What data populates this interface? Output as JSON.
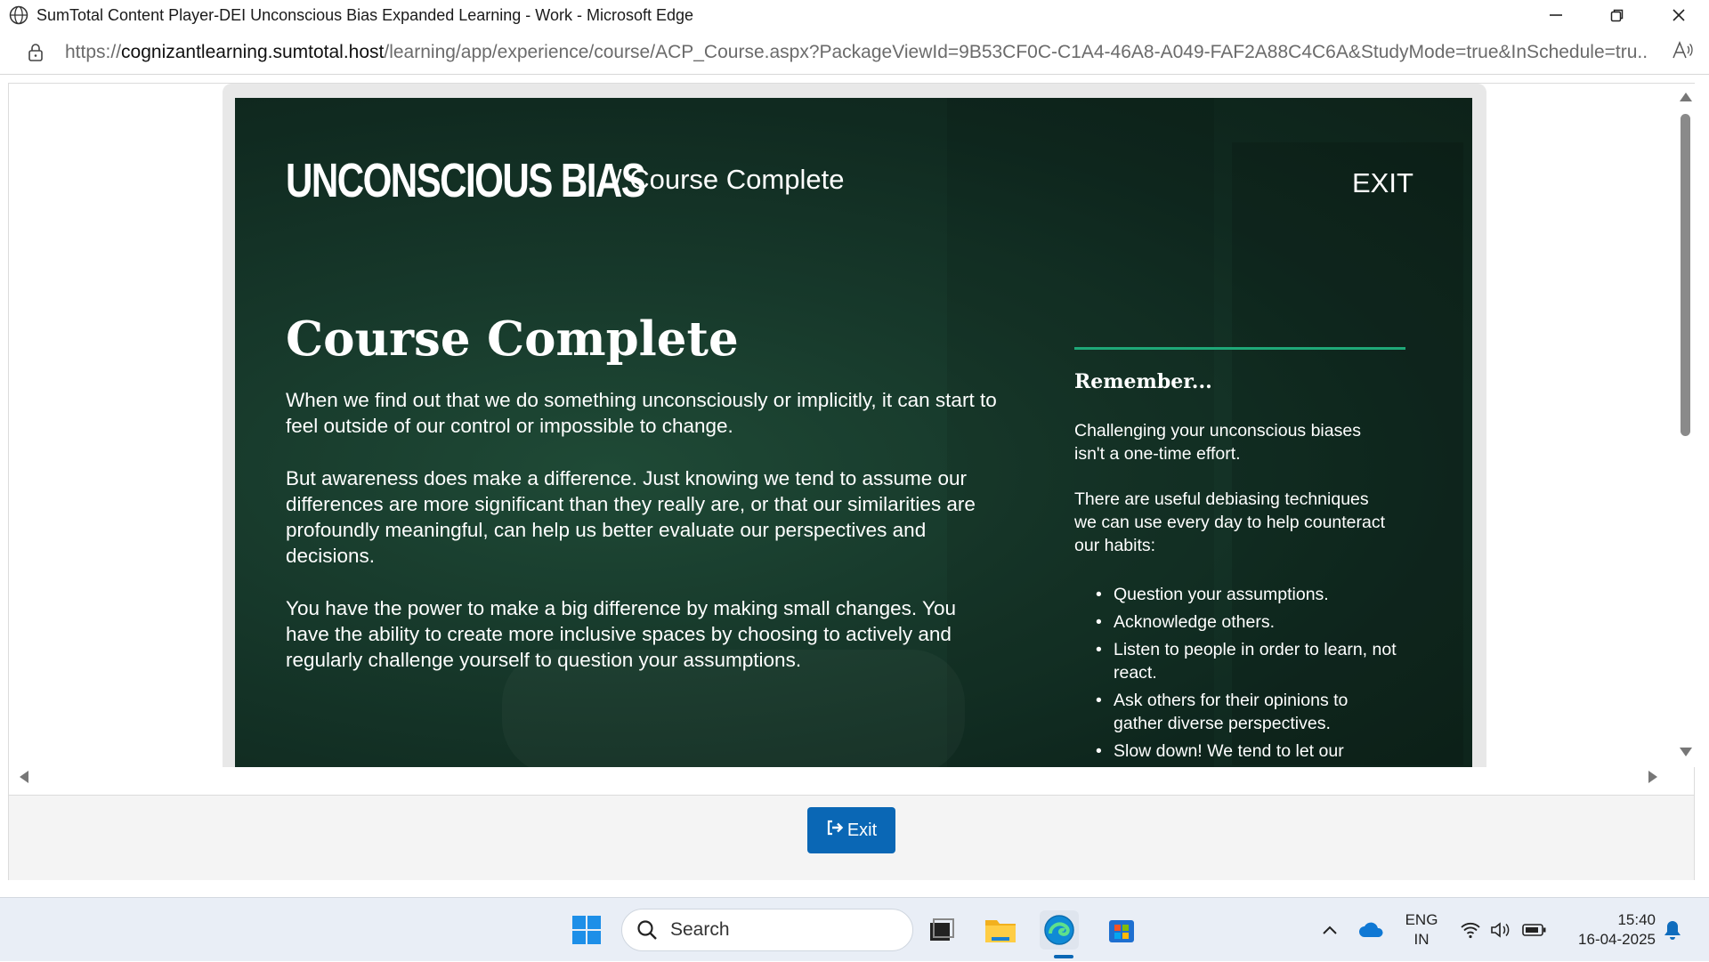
{
  "window": {
    "title": "SumTotal Content Player-DEI Unconscious Bias Expanded Learning - Work - Microsoft Edge"
  },
  "address": {
    "url_prefix": "https://",
    "url_host": "cognizantlearning.sumtotal.host",
    "url_path": "/learning/app/experience/course/ACP_Course.aspx?PackageViewId=9B53CF0C-C1A4-46A8-A049-FAF2A88C4C6A&StudyMode=true&InSchedule=tru..."
  },
  "course": {
    "brand": "UNCONSCIOUS BIAS",
    "breadcrumb": "/ Course Complete",
    "exit_link": "EXIT",
    "heading": "Course Complete",
    "paragraphs": [
      "When we find out that we do something unconsciously or implicitly, it can start to feel outside of our control or impossible to change.",
      "But awareness does make a difference. Just knowing we tend to assume our differences are more significant than they really are, or that our similarities are profoundly meaningful, can help us better evaluate our perspectives and decisions.",
      "You have the power to make a big difference by making small changes. You have the ability to create more inclusive spaces by choosing to actively and regularly challenge yourself to question your assumptions."
    ],
    "remember": {
      "title": "Remember...",
      "text1": "Challenging your unconscious biases isn't a one-time effort.",
      "text2": "There are useful debiasing techniques we can use every day to help counteract our habits:",
      "tips": [
        "Question your assumptions.",
        "Acknowledge others.",
        "Listen to people in order to learn, not react.",
        "Ask others for their opinions to gather diverse perspectives.",
        "Slow down! We tend to let our"
      ]
    }
  },
  "footer": {
    "exit_button": "Exit"
  },
  "taskbar": {
    "search_label": "Search",
    "lang_line1": "ENG",
    "lang_line2": "IN",
    "time": "15:40",
    "date": "16-04-2025"
  },
  "colors": {
    "accent_green": "#1fa878",
    "exit_button_blue": "#0a67b5",
    "course_bg": "#17392b"
  }
}
